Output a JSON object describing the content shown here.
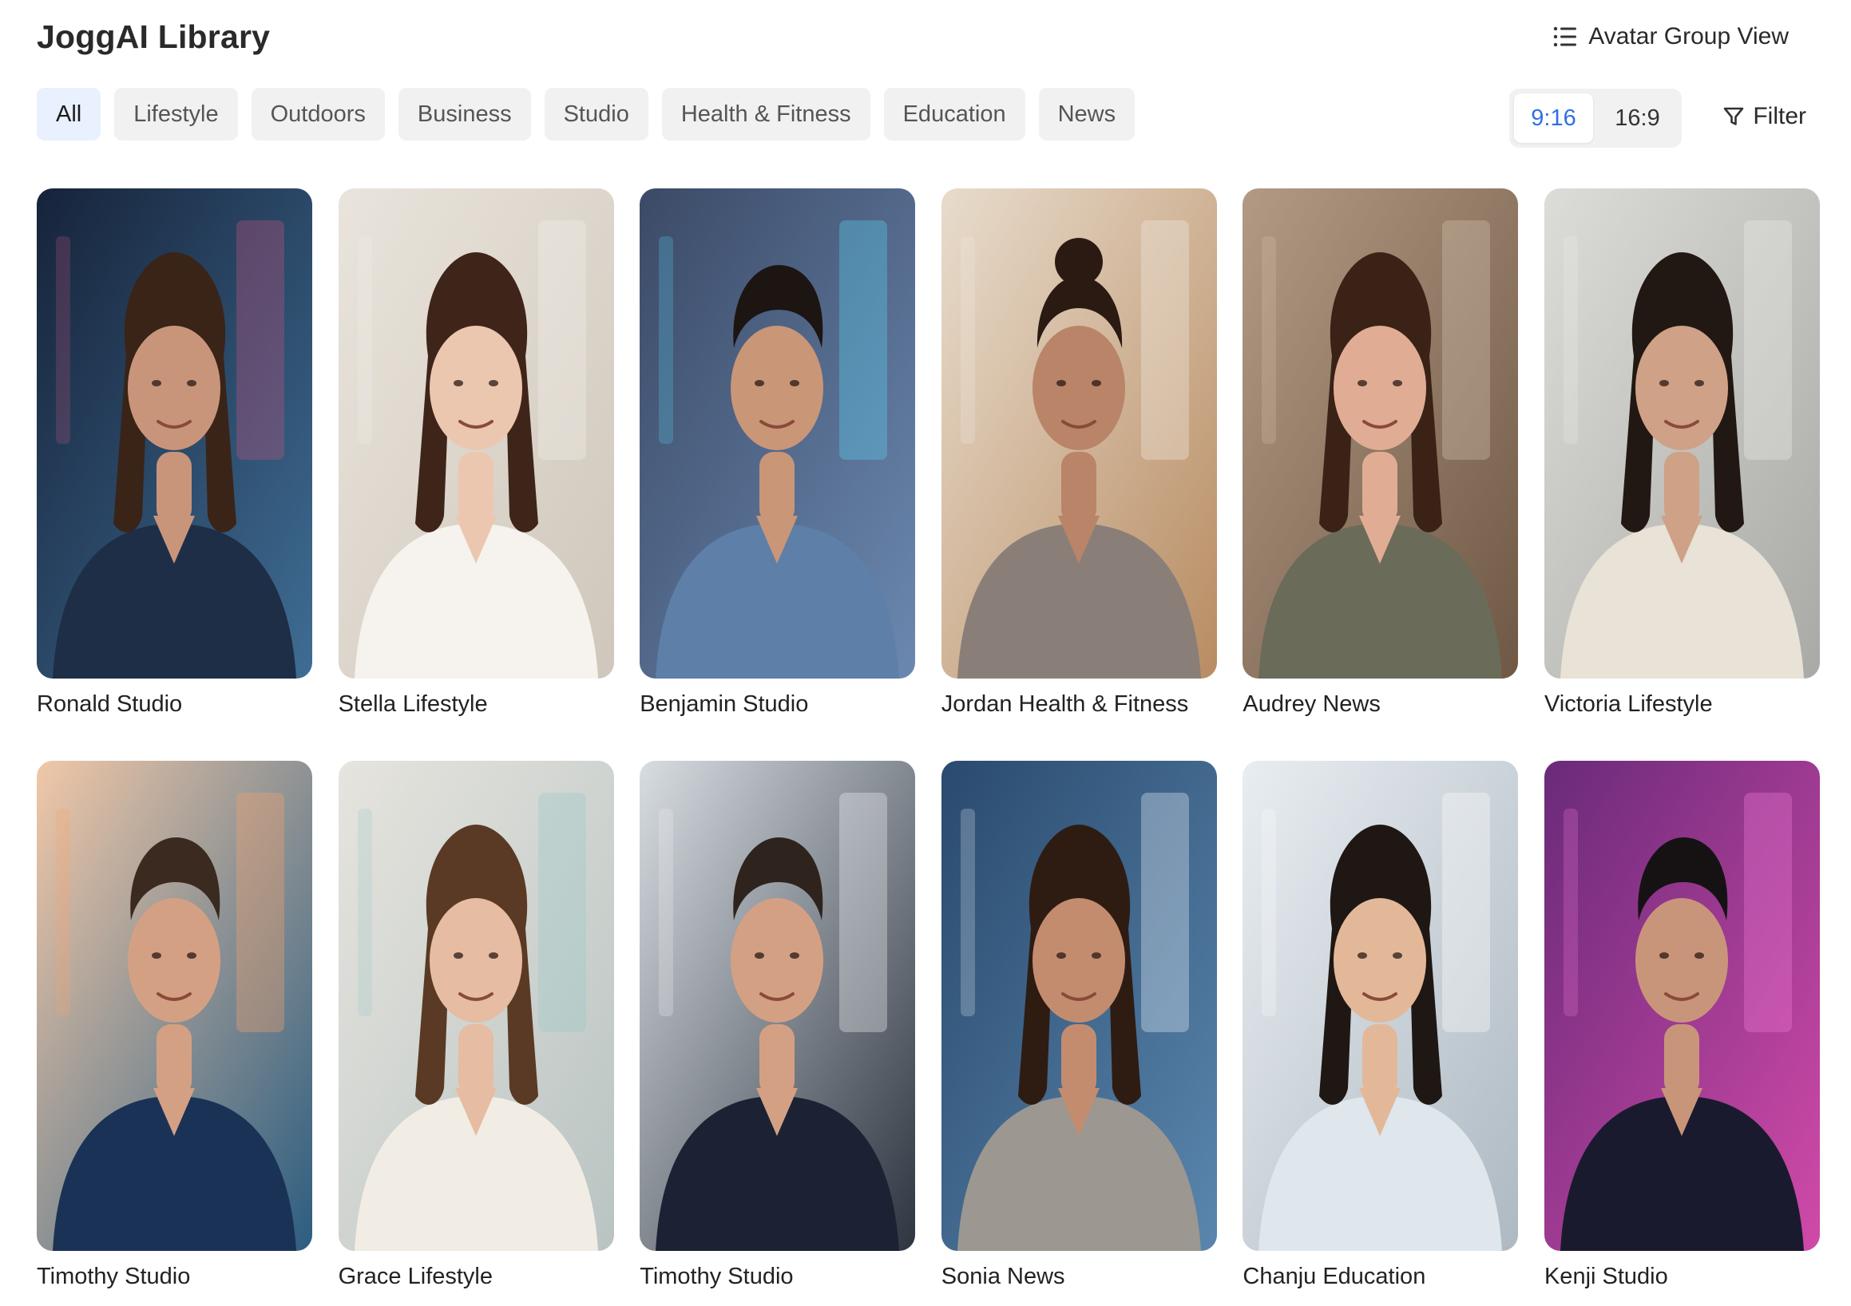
{
  "header": {
    "title": "JoggAI Library",
    "group_view_label": "Avatar Group View",
    "group_view_icon": "list-icon"
  },
  "categories": [
    {
      "label": "All",
      "active": true
    },
    {
      "label": "Lifestyle",
      "active": false
    },
    {
      "label": "Outdoors",
      "active": false
    },
    {
      "label": "Business",
      "active": false
    },
    {
      "label": "Studio",
      "active": false
    },
    {
      "label": "Health & Fitness",
      "active": false
    },
    {
      "label": "Education",
      "active": false
    },
    {
      "label": "News",
      "active": false
    }
  ],
  "ratio_toggle": {
    "options": [
      {
        "label": "9:16",
        "active": true
      },
      {
        "label": "16:9",
        "active": false
      }
    ],
    "active_color": "#2f6fe6"
  },
  "filter": {
    "label": "Filter",
    "icon": "funnel-icon"
  },
  "avatars": [
    {
      "name": "Ronald Studio",
      "bg": [
        "#16233a",
        "#3f6d94"
      ],
      "accent": "#c0537d",
      "skin": "#c9957a",
      "hair": "#3a2418",
      "hair_style": "long",
      "shirt": "#1e2e47"
    },
    {
      "name": "Stella Lifestyle",
      "bg": [
        "#e9e4dc",
        "#cfc7bb"
      ],
      "accent": "#f4f1ec",
      "skin": "#ecc7b0",
      "hair": "#3f2519",
      "hair_style": "long",
      "shirt": "#f6f3ee"
    },
    {
      "name": "Benjamin Studio",
      "bg": [
        "#3b4a66",
        "#6b88b0"
      ],
      "accent": "#58d0f2",
      "skin": "#c99678",
      "hair": "#1c1512",
      "hair_style": "short",
      "shirt": "#5e7fa8"
    },
    {
      "name": "Jordan Health & Fitness",
      "bg": [
        "#e8dccd",
        "#b88c62"
      ],
      "accent": "#f3ede4",
      "skin": "#b98468",
      "hair": "#2a1a12",
      "hair_style": "bun",
      "shirt": "#8a7f78"
    },
    {
      "name": "Audrey News",
      "bg": [
        "#b29a84",
        "#6f5845"
      ],
      "accent": "#d8c6b1",
      "skin": "#e0ad94",
      "hair": "#3a2217",
      "hair_style": "long",
      "shirt": "#6a6b58"
    },
    {
      "name": "Victoria Lifestyle",
      "bg": [
        "#dcdcd8",
        "#a9aaa5"
      ],
      "accent": "#eeeeea",
      "skin": "#cfa186",
      "hair": "#221813",
      "hair_style": "long",
      "shirt": "#e8e2d7"
    },
    {
      "name": "Timothy Studio",
      "bg": [
        "#f1c8a8",
        "#2c5d80"
      ],
      "accent": "#f6a46e",
      "skin": "#d4a084",
      "hair": "#3a2a20",
      "hair_style": "short",
      "shirt": "#1a3256"
    },
    {
      "name": "Grace Lifestyle",
      "bg": [
        "#e6e4de",
        "#b9c4c2"
      ],
      "accent": "#9cc8c8",
      "skin": "#e6bca2",
      "hair": "#5a3a24",
      "hair_style": "long",
      "shirt": "#f1ede5"
    },
    {
      "name": "Timothy Studio",
      "bg": [
        "#d8dde2",
        "#2e3540"
      ],
      "accent": "#f2f4f6",
      "skin": "#d4a084",
      "hair": "#2e241d",
      "hair_style": "short",
      "shirt": "#1b2233"
    },
    {
      "name": "Sonia News",
      "bg": [
        "#2a4a6e",
        "#5a86ad"
      ],
      "accent": "#e9f1fa",
      "skin": "#c48c6f",
      "hair": "#2e1c13",
      "hair_style": "long",
      "shirt": "#9c9791"
    },
    {
      "name": "Chanju Education",
      "bg": [
        "#e8edf1",
        "#aeb9c2"
      ],
      "accent": "#ffffff",
      "skin": "#e3b899",
      "hair": "#1f1713",
      "hair_style": "long",
      "shirt": "#dfe6ec"
    },
    {
      "name": "Kenji Studio",
      "bg": [
        "#6a2a7a",
        "#d04aa8"
      ],
      "accent": "#f07ad6",
      "skin": "#c9957a",
      "hair": "#161214",
      "hair_style": "short",
      "shirt": "#1a1a2e"
    }
  ]
}
